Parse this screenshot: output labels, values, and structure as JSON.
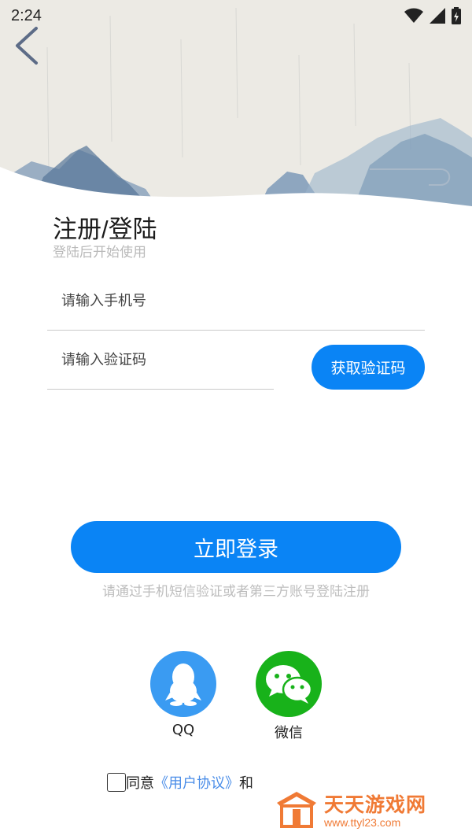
{
  "status_bar": {
    "time": "2:24"
  },
  "header": {
    "title": "注册/登陆",
    "subtitle": "登陆后开始使用"
  },
  "form": {
    "phone_placeholder": "请输入手机号",
    "code_placeholder": "请输入验证码",
    "get_code_label": "获取验证码"
  },
  "login": {
    "button_label": "立即登录",
    "hint": "请通过手机短信验证或者第三方账号登陆注册"
  },
  "social": [
    {
      "label": "QQ",
      "icon": "qq-icon"
    },
    {
      "label": "微信",
      "icon": "wechat-icon"
    }
  ],
  "agreement": {
    "prefix": "同意",
    "link": "《用户协议》",
    "suffix": "和"
  },
  "watermark": {
    "title": "天天游戏网",
    "url": "www.ttyl23.com"
  },
  "colors": {
    "primary": "#0a84f5",
    "qq": "#3a9bf2",
    "wechat": "#18b21a",
    "link": "#4a8de8",
    "watermark": "#f07a35"
  }
}
